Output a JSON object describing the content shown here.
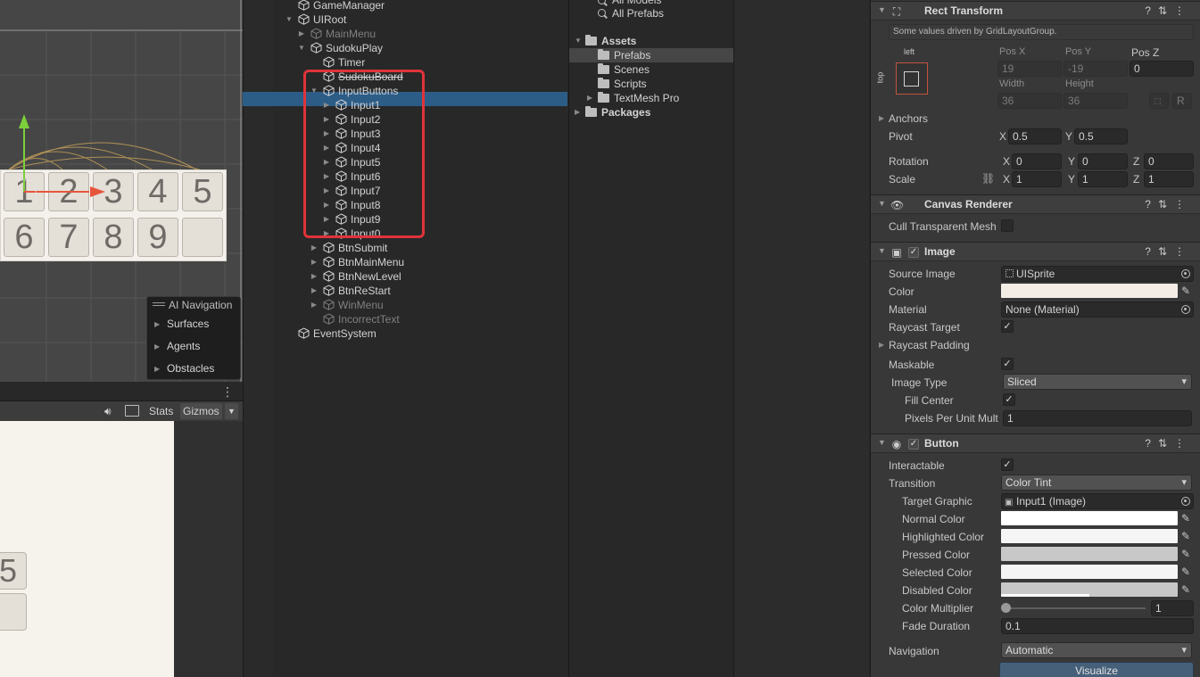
{
  "scene": {
    "board_row1": [
      "1",
      "2",
      "3",
      "4",
      "5"
    ],
    "board_row2": [
      "6",
      "7",
      "8",
      "9",
      ""
    ],
    "ai_navigation": {
      "title": "AI Navigation",
      "items": [
        "Surfaces",
        "Agents",
        "Obstacles"
      ]
    }
  },
  "game_view": {
    "kebab": "⋮",
    "toolbar": {
      "stats": "Stats",
      "gizmos": "Gizmos"
    },
    "cells": [
      "5",
      ""
    ]
  },
  "hierarchy": {
    "rows": [
      {
        "label": "GameManager",
        "depth": 0,
        "arrow": ""
      },
      {
        "label": "UIRoot",
        "depth": 0,
        "arrow": "down"
      },
      {
        "label": "MainMenu",
        "depth": 1,
        "arrow": "right",
        "dim": true
      },
      {
        "label": "SudokuPlay",
        "depth": 1,
        "arrow": "down"
      },
      {
        "label": "Timer",
        "depth": 2,
        "arrow": ""
      },
      {
        "label": "SudokuBoard",
        "depth": 2,
        "arrow": ""
      },
      {
        "label": "InputButtons",
        "depth": 2,
        "arrow": "down"
      },
      {
        "label": "Input1",
        "depth": 3,
        "arrow": "right",
        "selected": true
      },
      {
        "label": "Input2",
        "depth": 3,
        "arrow": "right"
      },
      {
        "label": "Input3",
        "depth": 3,
        "arrow": "right"
      },
      {
        "label": "Input4",
        "depth": 3,
        "arrow": "right"
      },
      {
        "label": "Input5",
        "depth": 3,
        "arrow": "right"
      },
      {
        "label": "Input6",
        "depth": 3,
        "arrow": "right"
      },
      {
        "label": "Input7",
        "depth": 3,
        "arrow": "right"
      },
      {
        "label": "Input8",
        "depth": 3,
        "arrow": "right"
      },
      {
        "label": "Input9",
        "depth": 3,
        "arrow": "right"
      },
      {
        "label": "Input0",
        "depth": 3,
        "arrow": "right"
      },
      {
        "label": "BtnSubmit",
        "depth": 2,
        "arrow": "right"
      },
      {
        "label": "BtnMainMenu",
        "depth": 2,
        "arrow": "right"
      },
      {
        "label": "BtnNewLevel",
        "depth": 2,
        "arrow": "right"
      },
      {
        "label": "BtnReStart",
        "depth": 2,
        "arrow": "right"
      },
      {
        "label": "WinMenu",
        "depth": 2,
        "arrow": "right",
        "dim": true
      },
      {
        "label": "IncorrectText",
        "depth": 2,
        "arrow": "",
        "dim": true
      },
      {
        "label": "EventSystem",
        "depth": 0,
        "arrow": ""
      }
    ]
  },
  "project": {
    "search_items": [
      "All Models",
      "All Prefabs"
    ],
    "tree": [
      {
        "label": "Assets",
        "depth": 0,
        "arrow": "down",
        "bold": true
      },
      {
        "label": "Prefabs",
        "depth": 1,
        "arrow": "",
        "selected": true
      },
      {
        "label": "Scenes",
        "depth": 1,
        "arrow": ""
      },
      {
        "label": "Scripts",
        "depth": 1,
        "arrow": ""
      },
      {
        "label": "TextMesh Pro",
        "depth": 1,
        "arrow": "right"
      },
      {
        "label": "Packages",
        "depth": 0,
        "arrow": "right",
        "bold": true
      }
    ]
  },
  "inspector": {
    "rect_transform": {
      "title": "Rect Transform",
      "driven_note": "Some values driven by GridLayoutGroup.",
      "anchor_h": "left",
      "anchor_v": "top",
      "pos_x_label": "Pos X",
      "pos_x": "19",
      "pos_y_label": "Pos Y",
      "pos_y": "-19",
      "pos_z_label": "Pos Z",
      "pos_z": "0",
      "width_label": "Width",
      "width": "36",
      "height_label": "Height",
      "height": "36",
      "r_button": "R",
      "anchors_label": "Anchors",
      "pivot_label": "Pivot",
      "pivot_x": "0.5",
      "pivot_y": "0.5",
      "rotation_label": "Rotation",
      "rot_x": "0",
      "rot_y": "0",
      "rot_z": "0",
      "scale_label": "Scale",
      "scale_x": "1",
      "scale_y": "1",
      "scale_z": "1",
      "axis_x": "X",
      "axis_y": "Y",
      "axis_z": "Z"
    },
    "canvas_renderer": {
      "title": "Canvas Renderer",
      "cull_label": "Cull Transparent Mesh"
    },
    "image": {
      "title": "Image",
      "source_image_label": "Source Image",
      "source_image": "UISprite",
      "color_label": "Color",
      "color": "#f3ede6",
      "material_label": "Material",
      "material": "None (Material)",
      "raycast_target_label": "Raycast Target",
      "raycast_padding_label": "Raycast Padding",
      "maskable_label": "Maskable",
      "image_type_label": "Image Type",
      "image_type": "Sliced",
      "fill_center_label": "Fill Center",
      "ppu_label": "Pixels Per Unit Mult",
      "ppu": "1"
    },
    "button": {
      "title": "Button",
      "interactable_label": "Interactable",
      "transition_label": "Transition",
      "transition": "Color Tint",
      "target_graphic_label": "Target Graphic",
      "target_graphic": "Input1 (Image)",
      "normal_color_label": "Normal Color",
      "normal_color": "#ffffff",
      "highlighted_color_label": "Highlighted Color",
      "highlighted_color": "#f5f5f5",
      "pressed_color_label": "Pressed Color",
      "pressed_color": "#c8c8c8",
      "selected_color_label": "Selected Color",
      "selected_color": "#f5f5f5",
      "disabled_color_label": "Disabled Color",
      "disabled_color": "#c8c8c8",
      "disabled_alpha": 0.5,
      "color_multiplier_label": "Color Multiplier",
      "color_multiplier": "1",
      "fade_duration_label": "Fade Duration",
      "fade_duration": "0.1",
      "navigation_label": "Navigation",
      "navigation": "Automatic",
      "visualize": "Visualize"
    }
  },
  "colors": {
    "selection": "#2c5d87",
    "highlight_box": "#e0333a",
    "gizmo_x": "#e8553d",
    "gizmo_y": "#7ccf3a"
  }
}
